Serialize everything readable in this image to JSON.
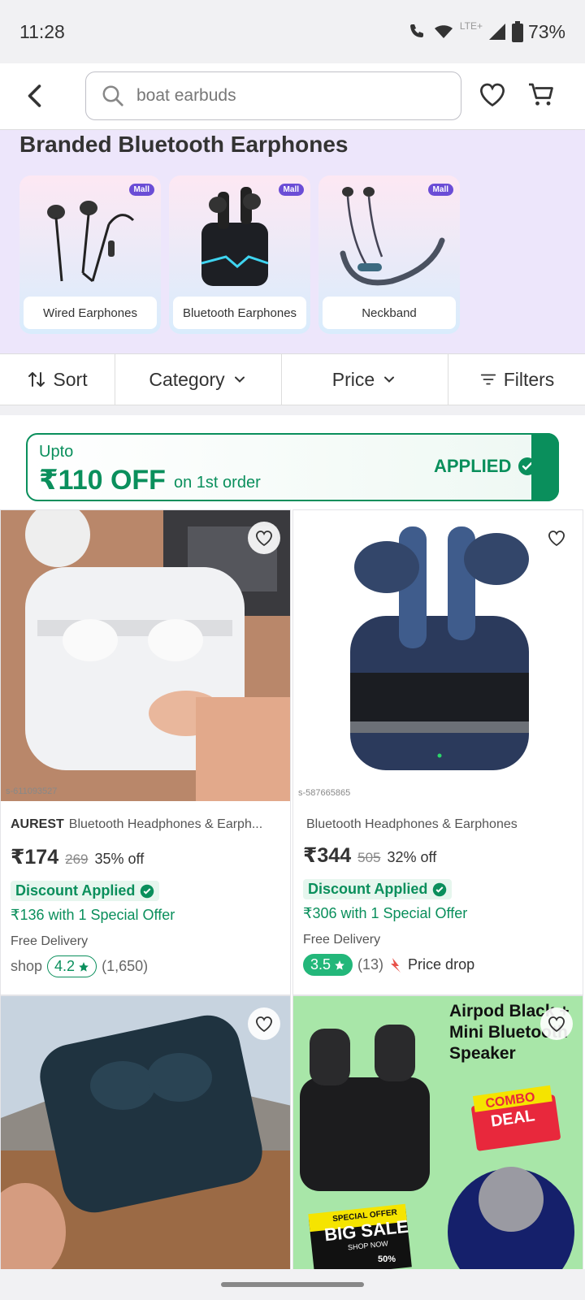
{
  "status": {
    "time": "11:28",
    "network": "LTE+",
    "battery": "73%"
  },
  "search": {
    "query": "boat earbuds"
  },
  "branded": {
    "title": "Branded Bluetooth Earphones",
    "badge": "Mall",
    "categories": [
      {
        "label": "Wired Earphones"
      },
      {
        "label": "Bluetooth Earphones"
      },
      {
        "label": "Neckband"
      }
    ]
  },
  "filters": {
    "sort": "Sort",
    "category": "Category",
    "price": "Price",
    "filters": "Filters"
  },
  "offer": {
    "upto": "Upto",
    "amount": "₹110 OFF",
    "suffix": "on 1st order",
    "status": "APPLIED"
  },
  "products": [
    {
      "sku": "s-611093527",
      "brand": "AUREST",
      "name": "Bluetooth Headphones & Earph...",
      "price": "₹174",
      "mrp": "269",
      "discount": "35% off",
      "discount_label": "Discount Applied",
      "special": "₹136 with 1 Special Offer",
      "delivery": "Free Delivery",
      "seller": "shop",
      "rating": "4.2",
      "reviews": "(1,650)"
    },
    {
      "sku": "s-587665865",
      "brand": "",
      "name": "Bluetooth Headphones & Earphones",
      "price": "₹344",
      "mrp": "505",
      "discount": "32% off",
      "discount_label": "Discount Applied",
      "special": "₹306 with 1 Special Offer",
      "delivery": "Free Delivery",
      "rating": "3.5",
      "reviews": "(13)",
      "tag": "Price drop"
    },
    {
      "image": "black-earbuds-case-hand"
    },
    {
      "image_text": [
        "Airpod Black +",
        "Mini Bluetooth",
        "Speaker"
      ],
      "combo": [
        "COMBO",
        "DEAL"
      ],
      "sale": [
        "SPECIAL OFFER",
        "BIG SALE",
        "SHOP NOW"
      ],
      "sale_pct": "50%"
    }
  ],
  "colors": {
    "accent": "#0a8f5c",
    "brand": "#6b4dd6",
    "section_bg": "#ede6fb"
  }
}
